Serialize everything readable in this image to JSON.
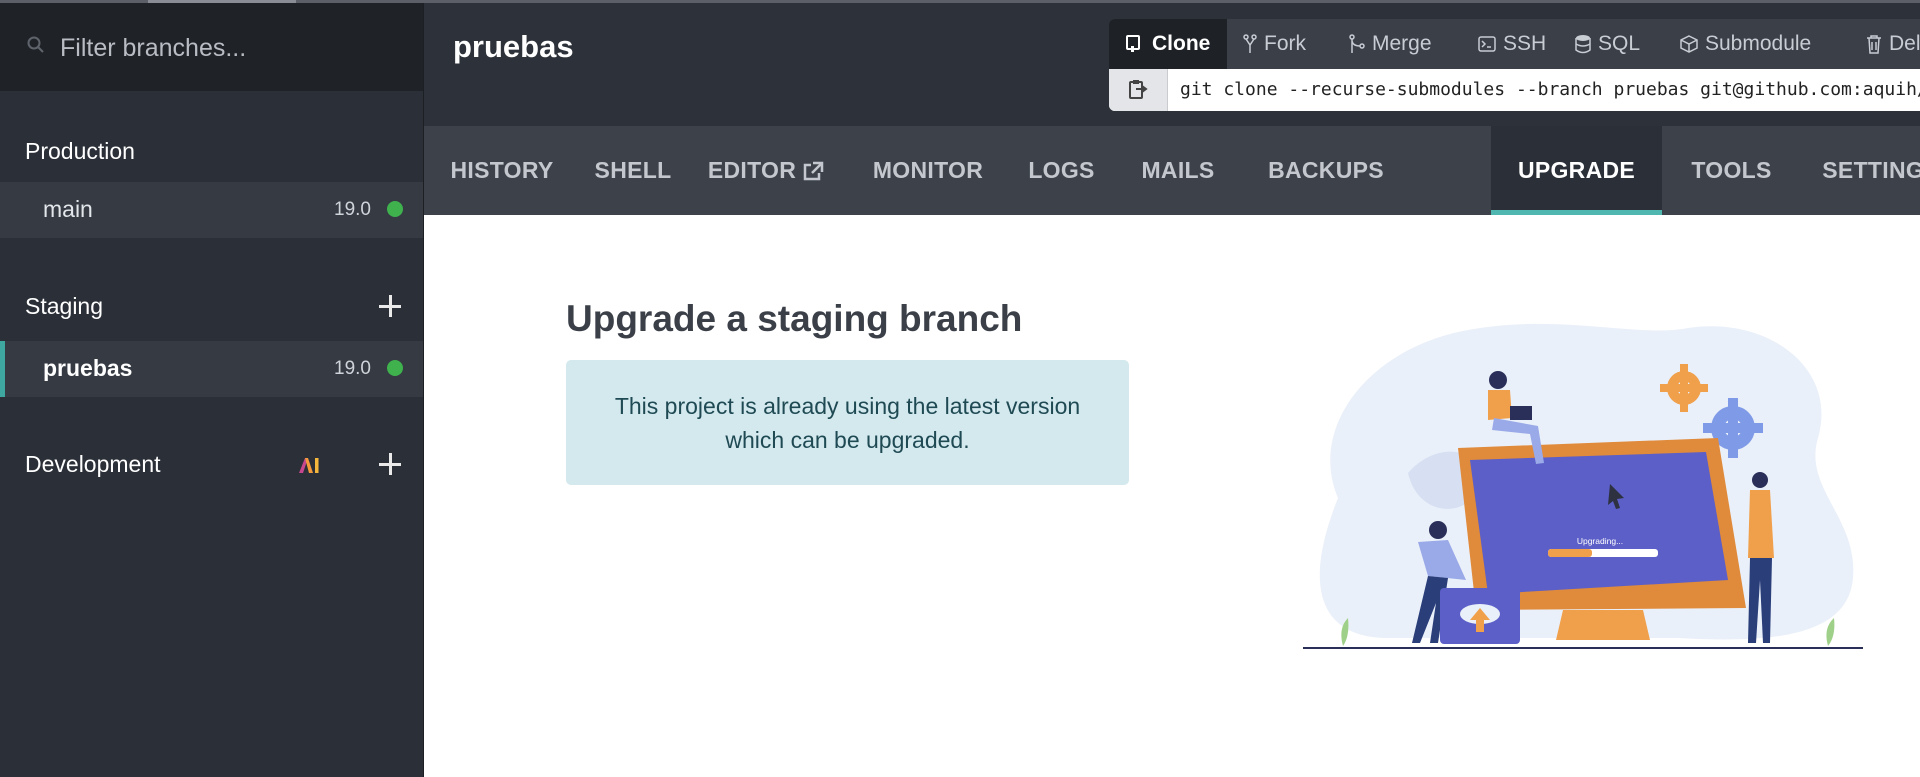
{
  "sidebar": {
    "filter_placeholder": "Filter branches...",
    "groups": [
      {
        "title": "Production",
        "branches": [
          {
            "name": "main",
            "version": "19.0",
            "status_color": "#3fb24e"
          }
        ]
      },
      {
        "title": "Staging",
        "branches": [
          {
            "name": "pruebas",
            "version": "19.0",
            "status_color": "#3fb24e",
            "active": true
          }
        ]
      },
      {
        "title": "Development",
        "branches": []
      }
    ]
  },
  "header": {
    "project_title": "pruebas",
    "tools": [
      "Clone",
      "Fork",
      "Merge",
      "SSH",
      "SQL",
      "Submodule",
      "Delete"
    ],
    "selected_tool": "Clone",
    "clone_command": "git clone --recurse-submodules --branch pruebas git@github.com:aquih/"
  },
  "tabs": {
    "items": [
      "HISTORY",
      "SHELL",
      "EDITOR",
      "MONITOR",
      "LOGS",
      "MAILS",
      "BACKUPS",
      "UPGRADE",
      "TOOLS",
      "SETTINGS"
    ],
    "selected": "UPGRADE"
  },
  "content": {
    "title": "Upgrade a staging branch",
    "alert_line1": "This project is already using the latest version",
    "alert_line2": "which can be upgraded.",
    "illustration_text": "Upgrading...",
    "progress": 0.4
  },
  "colors": {
    "accent": "#4fb6b0",
    "status_ok": "#3fb24e",
    "alert_bg": "#d3e9ee",
    "monitor_screen": "#5b5fc7",
    "illustration_orange": "#f0a04b"
  },
  "icons": [
    "search-icon",
    "clone-icon",
    "fork-icon",
    "merge-icon",
    "ssh-icon",
    "sql-icon",
    "submodule-icon",
    "delete-icon",
    "copy-icon",
    "external-link-icon",
    "plus-icon",
    "ai-logo-icon",
    "status-dot-icon"
  ]
}
